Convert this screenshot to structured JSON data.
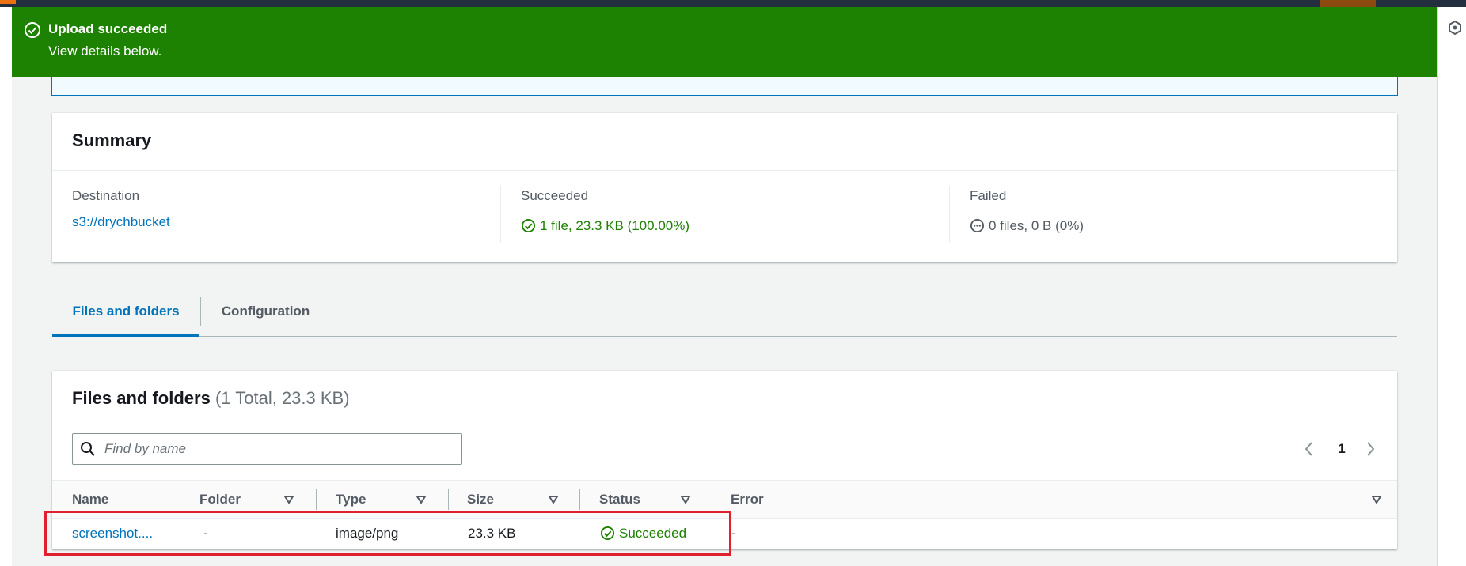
{
  "flash": {
    "title": "Upload succeeded",
    "message": "View details below.",
    "color": "#1d8102",
    "icon": "check-circle-icon"
  },
  "summary": {
    "title": "Summary",
    "destination": {
      "label": "Destination",
      "value": "s3://drychbucket"
    },
    "succeeded": {
      "label": "Succeeded",
      "value": "1 file, 23.3 KB (100.00%)",
      "icon": "check-circle-icon"
    },
    "failed": {
      "label": "Failed",
      "value": "0 files, 0 B (0%)",
      "icon": "ellipsis-circle-icon"
    }
  },
  "tabs": [
    {
      "label": "Files and folders",
      "active": true
    },
    {
      "label": "Configuration",
      "active": false
    }
  ],
  "files": {
    "title": "Files and folders",
    "count": "(1 Total, 23.3 KB)",
    "search": {
      "placeholder": "Find by name",
      "value": ""
    },
    "pagination": {
      "current_page": "1"
    },
    "columns": [
      "Name",
      "Folder",
      "Type",
      "Size",
      "Status",
      "Error"
    ],
    "rows": [
      {
        "name": "screenshot....",
        "folder": "-",
        "type": "image/png",
        "size": "23.3 KB",
        "status": "Succeeded",
        "error": "-"
      }
    ]
  },
  "colors": {
    "link": "#0073bb",
    "success": "#1d8102",
    "highlight": "#e0202f"
  }
}
